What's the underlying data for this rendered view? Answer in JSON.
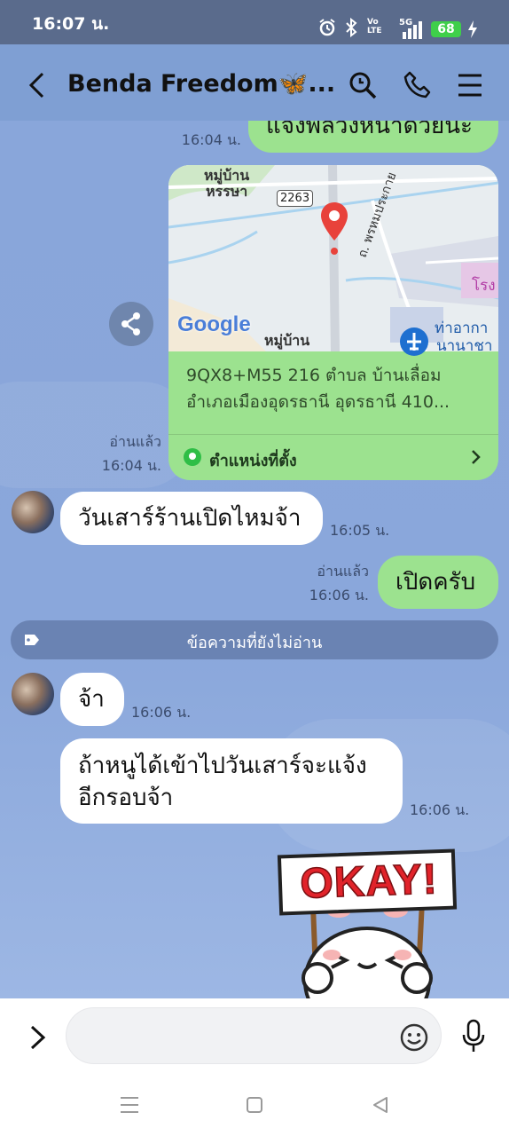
{
  "status": {
    "time": "16:07 น.",
    "net_label": "5G",
    "volte_label": "Vo LTE",
    "battery": "68"
  },
  "header": {
    "title": "Benda Freedom🦋..."
  },
  "messages": {
    "top_partial_text": "แจ้งพี่ล่วงหน้าด้วยนะ",
    "top_partial_time": "16:04 น.",
    "map": {
      "labels": [
        "หมู่บ้าน",
        "หรรษา",
        "2263",
        "ถ. พรหมประกาย",
        "ท่าอากา",
        "นานาชา",
        "โรง",
        "หมู่บ้าน"
      ],
      "google": "Google",
      "address": "9QX8+M55 216 ตำบล บ้านเลื่อม อำเภอเมืองอุดรธานี อุดรธานี 410...",
      "location_label": "ตำแหน่งที่ตั้ง",
      "read": "อ่านแล้ว",
      "time": "16:04 น."
    },
    "m1": {
      "text": "วันเสาร์ร้านเปิดไหมจ้า",
      "time": "16:05 น."
    },
    "m2": {
      "text": "เปิดครับ",
      "read": "อ่านแล้ว",
      "time": "16:06 น."
    },
    "unread_divider": "ข้อความที่ยังไม่อ่าน",
    "m3": {
      "text": "จ้า",
      "time": "16:06 น."
    },
    "m4": {
      "text_line1": "ถ้าหนูได้เข้าไปวันเสาร์จะแจ้ง",
      "text_line2": "อีกรอบจ้า",
      "time": "16:06 น."
    },
    "sticker": {
      "sign_text": "OKAY!"
    }
  },
  "input": {
    "placeholder": ""
  },
  "colors": {
    "header_bg": "#5a6b8c",
    "chat_bg": "#89a6da",
    "my_bubble": "#9ce28f",
    "their_bubble": "#ffffff",
    "accent_green": "#2fbe46"
  },
  "icons": [
    "back-icon",
    "search-icon",
    "phone-icon",
    "menu-icon",
    "share-icon",
    "location-pin-icon",
    "chevron-right-icon",
    "tag-icon",
    "expand-icon",
    "emoji-icon",
    "mic-icon",
    "nav-menu-icon",
    "nav-home-icon",
    "nav-back-icon"
  ]
}
